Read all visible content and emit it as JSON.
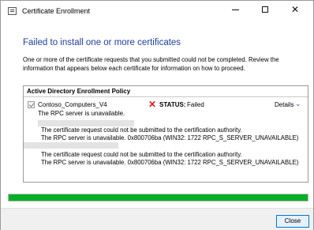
{
  "window": {
    "title": "Certificate Enrollment",
    "controls": {
      "minimize": "",
      "maximize": "",
      "close": "✕"
    }
  },
  "heading": "Failed to install one or more certificates",
  "intro": "One or more of the certificate requests that you submitted could not be completed. Review the information that appears below each certificate for information on how to proceed.",
  "panel": {
    "header": "Active Directory Enrollment Policy",
    "certificate": {
      "name": "Contoso_Computers_V4",
      "subtitle": "The RPC server is unavailable.",
      "status_label": "STATUS:",
      "status_value": "Failed",
      "details_label": "Details",
      "details_chevron": "⌄",
      "status_icon": "✕"
    },
    "errors": [
      {
        "line1": "The certificate request could not be submitted to the certification authority.",
        "line2": "The RPC server is unavailable. 0x800706ba (WIN32: 1722 RPC_S_SERVER_UNAVAILABLE)"
      },
      {
        "line1": "The certificate request could not be submitted to the certification authority.",
        "line2": "The RPC server is unavailable. 0x800706ba (WIN32: 1722 RPC_S_SERVER_UNAVAILABLE)"
      }
    ]
  },
  "progress": {
    "percent": 100,
    "color": "#06b025"
  },
  "footer": {
    "close_label": "Close"
  },
  "colors": {
    "heading": "#1f3d9b",
    "error_icon": "#d42020",
    "accent": "#0078d7"
  }
}
